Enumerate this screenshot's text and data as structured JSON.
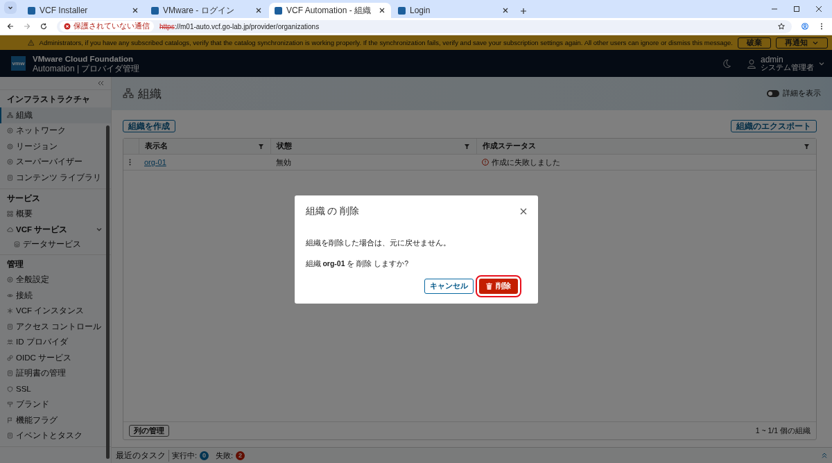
{
  "browser": {
    "tabs": [
      {
        "title": "VCF Installer",
        "selected": false
      },
      {
        "title": "VMware - ログイン",
        "selected": false
      },
      {
        "title": "VCF Automation - 組織",
        "selected": true
      },
      {
        "title": "Login",
        "selected": false
      }
    ],
    "security": "保護されていない通信",
    "url_scheme": "https",
    "url_rest": "://m01-auto.vcf.go-lab.jp/provider/organizations"
  },
  "banner": {
    "message": "Administrators, if you have any subscribed catalogs, verify that the catalog synchronization is working properly. If the synchronization fails, verify and save your subscription settings again. All other users can ignore or dismiss this message.",
    "buttons": [
      "破棄",
      "再通知"
    ]
  },
  "header": {
    "logo": "vmw",
    "product": "VMware Cloud Foundation",
    "subtitle": "Automation | プロバイダ管理",
    "user": "admin",
    "role": "システム管理者"
  },
  "sidebar": {
    "sections": [
      {
        "title": "インフラストラクチャ",
        "items": [
          {
            "label": "組織",
            "selected": true
          },
          {
            "label": "ネットワーク",
            "selected": false
          },
          {
            "label": "リージョン",
            "selected": false
          },
          {
            "label": "スーパーバイザー",
            "selected": false
          },
          {
            "label": "コンテンツ ライブラリ",
            "selected": false
          }
        ]
      },
      {
        "title": "サービス",
        "items": [
          {
            "label": "概要",
            "selected": false
          },
          {
            "label": "VCF サービス",
            "selected": false,
            "expanded": true,
            "children": [
              {
                "label": "データサービス",
                "selected": false
              }
            ]
          }
        ]
      },
      {
        "title": "管理",
        "items": [
          {
            "label": "全般設定",
            "selected": false
          },
          {
            "label": "接続",
            "selected": false
          },
          {
            "label": "VCF インスタンス",
            "selected": false
          },
          {
            "label": "アクセス コントロール",
            "selected": false
          },
          {
            "label": "ID プロバイダ",
            "selected": false
          },
          {
            "label": "OIDC サービス",
            "selected": false
          },
          {
            "label": "証明書の管理",
            "selected": false
          },
          {
            "label": "SSL",
            "selected": false
          },
          {
            "label": "ブランド",
            "selected": false
          },
          {
            "label": "機能フラグ",
            "selected": false
          },
          {
            "label": "イベントとタスク",
            "selected": false
          }
        ]
      }
    ]
  },
  "page": {
    "title": "組織",
    "toggle": {
      "label": "詳細を表示",
      "on": false
    },
    "create_button": "組織を作成",
    "export_button": "組織のエクスポート",
    "table": {
      "columns": [
        "表示名",
        "状態",
        "作成ステータス"
      ],
      "rows": [
        {
          "name": "org-01",
          "state": "無効",
          "status": "作成に失敗しました"
        }
      ]
    },
    "manage_columns": "列の管理",
    "count": "1 ~ 1/1 個の組織"
  },
  "tasks": {
    "title": "最近のタスク",
    "running_label": "実行中:",
    "running": "0",
    "failed_label": "失敗:",
    "failed": "2"
  },
  "dialog": {
    "title": "組織 の 削除",
    "message": "組織を削除した場合は、元に戻せません。",
    "question": "組織 **org-01** を 削除 しますか?",
    "cancel": "キャンセル",
    "confirm": "削除",
    "confirm_highlighted": true
  }
}
